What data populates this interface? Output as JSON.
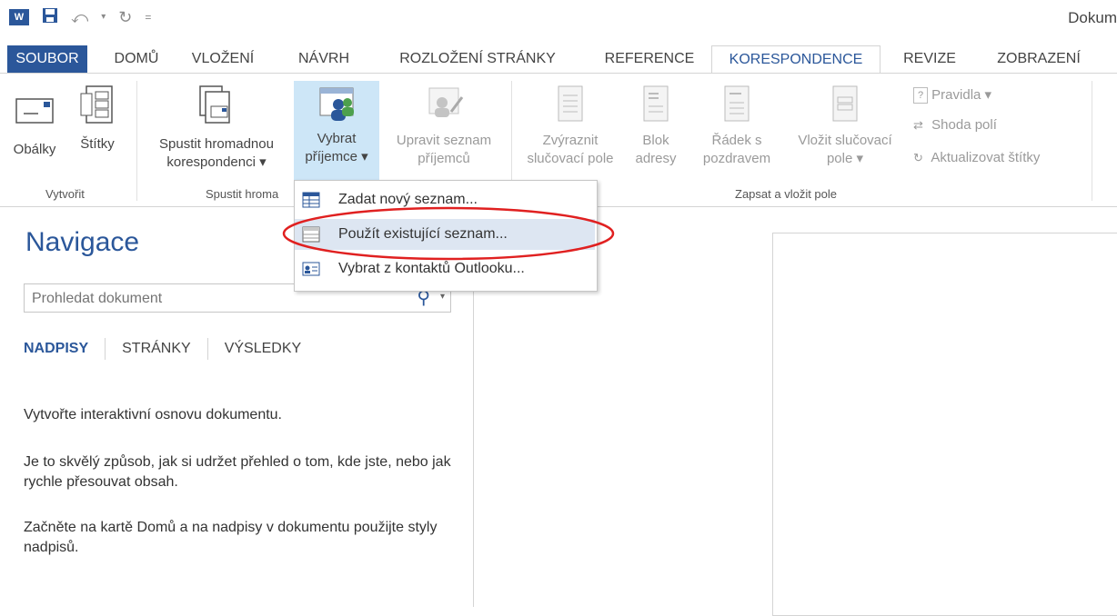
{
  "app": {
    "logo_letter": "W",
    "title": "Dokum"
  },
  "tabs": [
    {
      "label": "SOUBOR"
    },
    {
      "label": "DOMŮ"
    },
    {
      "label": "VLOŽENÍ"
    },
    {
      "label": "NÁVRH"
    },
    {
      "label": "ROZLOŽENÍ STRÁNKY"
    },
    {
      "label": "REFERENCE"
    },
    {
      "label": "KORESPONDENCE"
    },
    {
      "label": "REVIZE"
    },
    {
      "label": "ZOBRAZENÍ"
    }
  ],
  "ribbon": {
    "groups": {
      "create": "Vytvořit",
      "start_merge": "Spustit hroma",
      "write_insert": "Zapsat a vložit pole"
    },
    "buttons": {
      "envelopes": "Obálky",
      "labels": "Štítky",
      "start_merge_l1": "Spustit hromadnou",
      "start_merge_l2": "korespondenci ▾",
      "select_recipients_l1": "Vybrat",
      "select_recipients_l2": "příjemce ▾",
      "edit_list_l1": "Upravit seznam",
      "edit_list_l2": "příjemců",
      "highlight_l1": "Zvýraznit",
      "highlight_l2": "slučovací pole",
      "address_block_l1": "Blok",
      "address_block_l2": "adresy",
      "greeting_l1": "Řádek s",
      "greeting_l2": "pozdravem",
      "insert_field_l1": "Vložit slučovací",
      "insert_field_l2": "pole ▾",
      "rules": "Pravidla ▾",
      "match_fields": "Shoda polí",
      "update_labels": "Aktualizovat štítky"
    }
  },
  "dropdown": {
    "items": [
      {
        "label": "Zadat nový seznam..."
      },
      {
        "label": "Použít existující seznam..."
      },
      {
        "label": "Vybrat z kontaktů Outlooku..."
      }
    ]
  },
  "nav": {
    "title": "Navigace",
    "search_placeholder": "Prohledat dokument",
    "tabs": [
      "NADPISY",
      "STRÁNKY",
      "VÝSLEDKY"
    ],
    "text1": "Vytvořte interaktivní osnovu dokumentu.",
    "text2": "Je to skvělý způsob, jak si udržet přehled o tom, kde jste, nebo jak rychle přesouvat obsah.",
    "text3": "Začněte na kartě Domů a na nadpisy v dokumentu použijte styly nadpisů."
  },
  "colors": {
    "accent": "#2b579a",
    "selected_bg": "#cde6f7",
    "hover_bg": "#dde6f2",
    "annotation": "#e02020"
  },
  "icons": [
    "word-logo-icon",
    "save-icon",
    "undo-icon",
    "redo-icon",
    "customize-icon",
    "envelope-icon",
    "label-sheet-icon",
    "merge-doc-icon",
    "recipients-icon",
    "edit-recipients-icon",
    "highlight-fields-icon",
    "address-block-icon",
    "greeting-line-icon",
    "insert-field-icon",
    "rules-icon",
    "match-fields-icon",
    "update-labels-icon",
    "search-icon",
    "new-list-icon",
    "existing-list-icon",
    "outlook-contacts-icon"
  ]
}
